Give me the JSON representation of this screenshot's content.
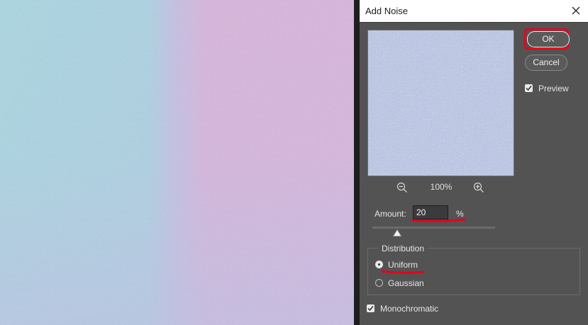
{
  "dialog": {
    "title": "Add Noise",
    "ok_label": "OK",
    "cancel_label": "Cancel",
    "preview_checkbox": {
      "label": "Preview",
      "checked": true
    },
    "zoom_level": "100%",
    "amount": {
      "label": "Amount:",
      "value": "20",
      "unit": "%",
      "slider_fraction": 0.2
    },
    "distribution": {
      "legend": "Distribution",
      "options": [
        {
          "label": "Uniform",
          "selected": true
        },
        {
          "label": "Gaussian",
          "selected": false
        }
      ]
    },
    "monochromatic": {
      "label": "Monochromatic",
      "checked": true
    }
  },
  "colors": {
    "canvas_left": "#a6d4de",
    "canvas_right": "#d7b2d9",
    "canvas_bottom_tint": "#bcbfe2",
    "dialog_bg": "#535353",
    "highlight_red": "#e6001e"
  }
}
